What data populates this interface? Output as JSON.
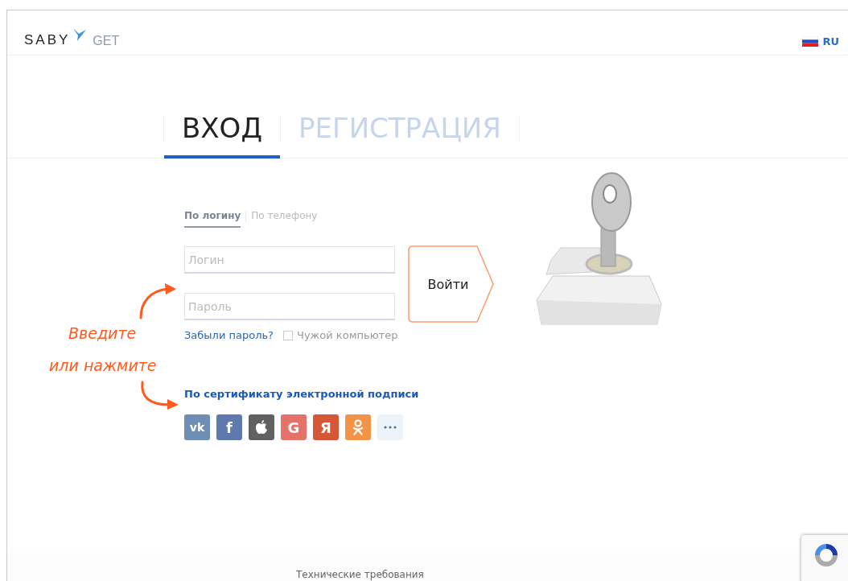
{
  "header": {
    "logo": {
      "brand": "SABY",
      "product": "GET"
    },
    "language": {
      "code": "RU"
    }
  },
  "tabs": [
    {
      "label": "ВХОД",
      "selected": true
    },
    {
      "label": "РЕГИСТРАЦИЯ",
      "selected": false
    }
  ],
  "login_mode_tabs": [
    {
      "label": "По логину",
      "selected": true
    },
    {
      "label": "По телефону",
      "selected": false
    }
  ],
  "form": {
    "login": {
      "placeholder": "Логин"
    },
    "password": {
      "placeholder": "Пароль"
    },
    "submit": "Войти",
    "forgot_link": "Забыли пароль?",
    "foreign_computer": {
      "label": "Чужой компьютер",
      "checked": false
    }
  },
  "annotation": {
    "lines": [
      "Введите",
      "или нажмите"
    ]
  },
  "certificate_link": "По сертификату электронной подписи",
  "social_buttons": [
    {
      "kind": "vk",
      "label": "vk",
      "color": "#6f8eb4"
    },
    {
      "kind": "facebook",
      "label": "f",
      "color": "#5e79ae"
    },
    {
      "kind": "apple",
      "color": "#616161"
    },
    {
      "kind": "google",
      "label": "G",
      "color": "#e4716a"
    },
    {
      "kind": "yandex",
      "label": "Я",
      "color": "#d65638"
    },
    {
      "kind": "ok",
      "color": "#f29347"
    },
    {
      "kind": "more",
      "color": "#eef3fa"
    }
  ],
  "footer": {
    "link": "Технические требования"
  }
}
